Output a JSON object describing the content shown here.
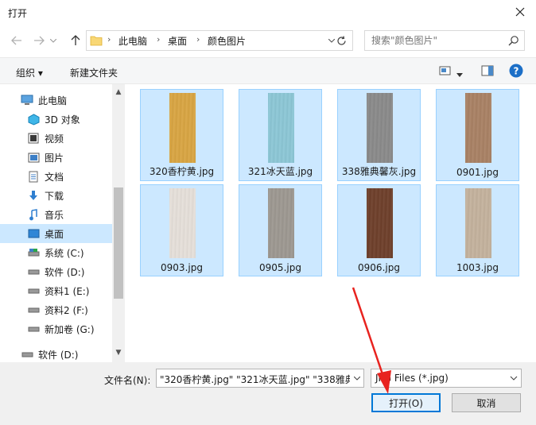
{
  "window": {
    "title": "打开"
  },
  "address": {
    "crumbs": [
      "此电脑",
      "桌面",
      "颜色图片"
    ]
  },
  "search": {
    "placeholder": "搜索\"颜色图片\""
  },
  "toolbar": {
    "organize": "组织 ▾",
    "new_folder": "新建文件夹",
    "help": "?"
  },
  "sidebar": {
    "items": [
      {
        "label": "此电脑",
        "icon": "computer-icon"
      },
      {
        "label": "3D 对象",
        "icon": "3d-objects-icon"
      },
      {
        "label": "视频",
        "icon": "video-icon"
      },
      {
        "label": "图片",
        "icon": "pictures-icon"
      },
      {
        "label": "文档",
        "icon": "documents-icon"
      },
      {
        "label": "下载",
        "icon": "download-icon"
      },
      {
        "label": "音乐",
        "icon": "music-icon"
      },
      {
        "label": "桌面",
        "icon": "desktop-icon",
        "selected": true
      },
      {
        "label": "系统 (C:)",
        "icon": "drive-icon"
      },
      {
        "label": "软件 (D:)",
        "icon": "drive-icon"
      },
      {
        "label": "资料1 (E:)",
        "icon": "drive-icon"
      },
      {
        "label": "资料2 (F:)",
        "icon": "drive-icon"
      },
      {
        "label": "新加卷 (G:)",
        "icon": "drive-icon"
      },
      {
        "label": "软件 (D:)",
        "icon": "drive-icon"
      }
    ]
  },
  "files": [
    {
      "name": "320香柠黄.jpg",
      "color": "#d9a542"
    },
    {
      "name": "321冰天蓝.jpg",
      "color": "#8cc7d6"
    },
    {
      "name": "338雅典馨灰.jpg",
      "color": "#8a8a8a"
    },
    {
      "name": "0901.jpg",
      "color": "#a98164"
    },
    {
      "name": "0903.jpg",
      "color": "#e6e0da"
    },
    {
      "name": "0905.jpg",
      "color": "#9d9891"
    },
    {
      "name": "0906.jpg",
      "color": "#6e3f2a"
    },
    {
      "name": "1003.jpg",
      "color": "#c4b29d"
    }
  ],
  "bottom": {
    "filename_label": "文件名(N):",
    "filename_value": "\"320香柠黄.jpg\" \"321冰天蓝.jpg\" \"338雅典",
    "filetype": "JPG Files (*.jpg)",
    "open_label": "打开(O)",
    "cancel_label": "取消"
  },
  "colors": {
    "accent": "#0078d7",
    "selection": "#cce8ff",
    "annotation_arrow": "#e8231f"
  }
}
